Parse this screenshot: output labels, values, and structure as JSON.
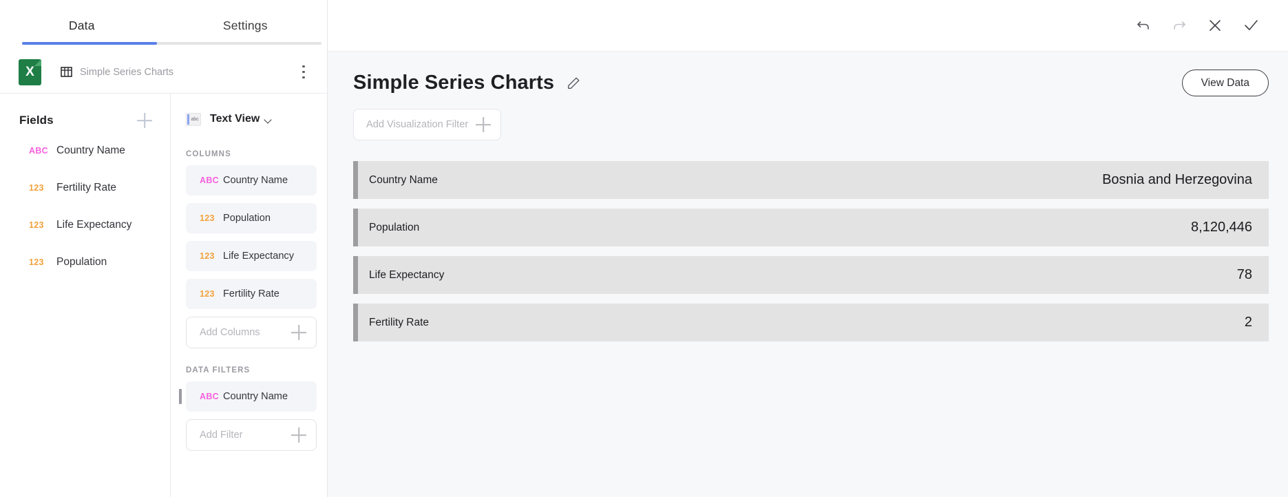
{
  "left_panel": {
    "tabs": [
      {
        "label": "Data",
        "active": true
      },
      {
        "label": "Settings",
        "active": false
      }
    ],
    "source": {
      "icon": "excel-file-icon",
      "table_icon": "table-grid-icon",
      "name": "Simple Series Charts",
      "menu_icon": "kebab-menu-icon"
    },
    "fields": {
      "title": "Fields",
      "add_icon": "plus-icon",
      "items": [
        {
          "type": "ABC",
          "label": "Country Name"
        },
        {
          "type": "123",
          "label": "Fertility Rate"
        },
        {
          "type": "123",
          "label": "Life Expectancy"
        },
        {
          "type": "123",
          "label": "Population"
        }
      ]
    },
    "config": {
      "view": {
        "label": "Text View",
        "thumb_text": "abc",
        "chevron_icon": "chevron-down-icon"
      },
      "columns_heading": "COLUMNS",
      "columns": [
        {
          "type": "ABC",
          "label": "Country Name"
        },
        {
          "type": "123",
          "label": "Population"
        },
        {
          "type": "123",
          "label": "Life Expectancy"
        },
        {
          "type": "123",
          "label": "Fertility Rate"
        }
      ],
      "add_columns_label": "Add Columns",
      "filters_heading": "DATA FILTERS",
      "filters": [
        {
          "type": "ABC",
          "label": "Country Name"
        }
      ],
      "add_filter_label": "Add Filter"
    }
  },
  "toolbar": {
    "undo_icon": "undo-icon",
    "redo_icon": "redo-icon",
    "close_icon": "close-x-icon",
    "confirm_icon": "checkmark-icon"
  },
  "main": {
    "title": "Simple Series Charts",
    "edit_icon": "pencil-edit-icon",
    "view_data_label": "View Data",
    "visualization_filter_label": "Add Visualization Filter",
    "visualization_filter_add_icon": "plus-icon",
    "rows": [
      {
        "key": "Country Name",
        "value": "Bosnia and Herzegovina"
      },
      {
        "key": "Population",
        "value": "8,120,446"
      },
      {
        "key": "Life Expectancy",
        "value": "78"
      },
      {
        "key": "Fertility Rate",
        "value": "2"
      }
    ]
  },
  "colors": {
    "accent_blue": "#5b7fe8",
    "excel_green": "#1e7e45",
    "type_text": "#f761df",
    "type_number": "#f2a23c",
    "row_bg": "#e3e3e4",
    "row_bar": "#9e9ea0",
    "canvas_bg": "#f7f8fa"
  }
}
